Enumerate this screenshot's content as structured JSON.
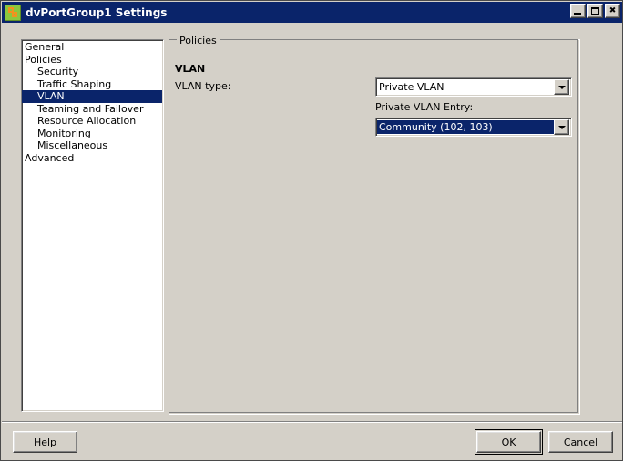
{
  "window": {
    "title": "dvPortGroup1 Settings",
    "icon": "dvportgroup-icon",
    "controls": {
      "minimize": "Minimize",
      "maximize": "Maximize",
      "close": "Close"
    }
  },
  "sidebar": {
    "items": [
      {
        "label": "General",
        "indent": false,
        "selected": false
      },
      {
        "label": "Policies",
        "indent": false,
        "selected": false
      },
      {
        "label": "Security",
        "indent": true,
        "selected": false
      },
      {
        "label": "Traffic Shaping",
        "indent": true,
        "selected": false
      },
      {
        "label": "VLAN",
        "indent": true,
        "selected": true
      },
      {
        "label": "Teaming and Failover",
        "indent": true,
        "selected": false
      },
      {
        "label": "Resource Allocation",
        "indent": true,
        "selected": false
      },
      {
        "label": "Monitoring",
        "indent": true,
        "selected": false
      },
      {
        "label": "Miscellaneous",
        "indent": true,
        "selected": false
      },
      {
        "label": "Advanced",
        "indent": false,
        "selected": false
      }
    ]
  },
  "panel": {
    "group_legend": "Policies",
    "heading": "VLAN",
    "vlan_type_label": "VLAN type:",
    "vlan_type_value": "Private VLAN",
    "pvlan_entry_label": "Private VLAN Entry:",
    "pvlan_entry_value": "Community (102, 103)"
  },
  "footer": {
    "help": "Help",
    "ok": "OK",
    "cancel": "Cancel"
  },
  "colors": {
    "titlebar": "#0a246a",
    "selection": "#0a246a",
    "face": "#d4d0c8",
    "icon_green": "#8cc63e",
    "icon_orange": "#f3921e"
  }
}
